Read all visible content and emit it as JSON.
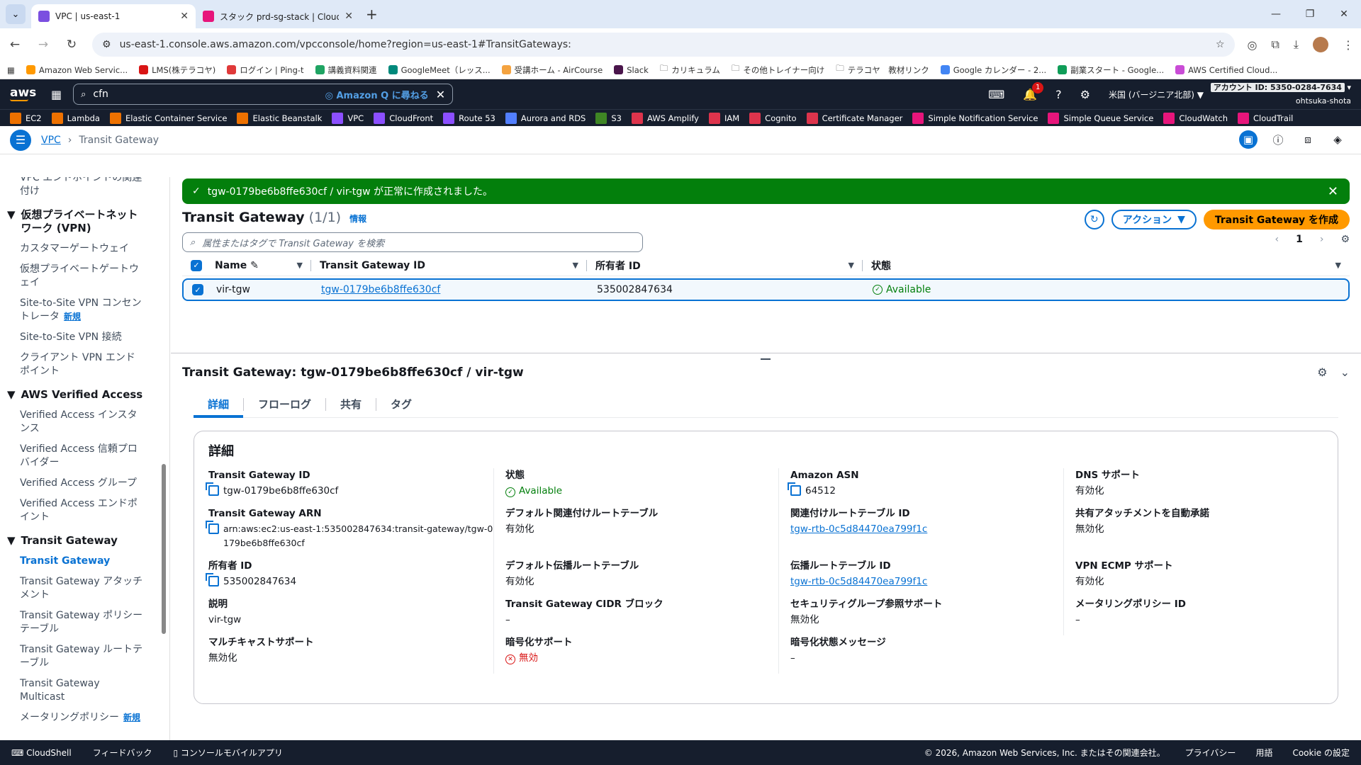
{
  "browser": {
    "tabs": [
      {
        "title": "VPC | us-east-1",
        "color": "#7b4fe0"
      },
      {
        "title": "スタック prd-sg-stack | CloudFor",
        "color": "#e7157b"
      }
    ],
    "url": "us-east-1.console.aws.amazon.com/vpcconsole/home?region=us-east-1#TransitGateways:"
  },
  "bookmarks": [
    {
      "label": "Amazon Web Servic...",
      "color": "#ff9900"
    },
    {
      "label": "LMS(株テラコヤ)",
      "color": "#d91515"
    },
    {
      "label": "ログイン | Ping-t",
      "color": "#e03a3a"
    },
    {
      "label": "講義資料関連",
      "color": "#1fa463"
    },
    {
      "label": "GoogleMeet（レッス...",
      "color": "#00897b"
    },
    {
      "label": "受講ホーム - AirCourse",
      "color": "#f4a340"
    },
    {
      "label": "Slack",
      "color": "#4a154b"
    },
    {
      "label": "カリキュラム",
      "color": "#777"
    },
    {
      "label": "その他トレイナー向け",
      "color": "#777"
    },
    {
      "label": "テラコヤ　教材リンク",
      "color": "#777"
    },
    {
      "label": "Google カレンダー - 2...",
      "color": "#4285f4"
    },
    {
      "label": "副業スタート - Google...",
      "color": "#0f9d58"
    },
    {
      "label": "AWS Certified Cloud...",
      "color": "#c94cd6"
    }
  ],
  "aws": {
    "search_value": "cfn",
    "amazon_q": "Amazon Q に尋ねる",
    "notification_count": "1",
    "region": "米国 (バージニア北部)",
    "account_id": "アカウント ID: 5350-0284-7634",
    "user": "ohtsuka-shota",
    "favorites": [
      {
        "label": "EC2",
        "color": "#ed7100"
      },
      {
        "label": "Lambda",
        "color": "#ed7100"
      },
      {
        "label": "Elastic Container Service",
        "color": "#ed7100"
      },
      {
        "label": "Elastic Beanstalk",
        "color": "#ed7100"
      },
      {
        "label": "VPC",
        "color": "#8c4fff"
      },
      {
        "label": "CloudFront",
        "color": "#8c4fff"
      },
      {
        "label": "Route 53",
        "color": "#8c4fff"
      },
      {
        "label": "Aurora and RDS",
        "color": "#527fff"
      },
      {
        "label": "S3",
        "color": "#3f8624"
      },
      {
        "label": "AWS Amplify",
        "color": "#dd344c"
      },
      {
        "label": "IAM",
        "color": "#dd344c"
      },
      {
        "label": "Cognito",
        "color": "#dd344c"
      },
      {
        "label": "Certificate Manager",
        "color": "#dd344c"
      },
      {
        "label": "Simple Notification Service",
        "color": "#e7157b"
      },
      {
        "label": "Simple Queue Service",
        "color": "#e7157b"
      },
      {
        "label": "CloudWatch",
        "color": "#e7157b"
      },
      {
        "label": "CloudTrail",
        "color": "#e7157b"
      }
    ]
  },
  "breadcrumb": {
    "root": "VPC",
    "current": "Transit Gateway"
  },
  "sidebar": {
    "items_top": [
      "VPC エンドポイントの関連付け"
    ],
    "vpn_section": "仮想プライベートネットワーク (VPN)",
    "vpn_items": [
      "カスタマーゲートウェイ",
      "仮想プライベートゲートウェイ",
      "Site-to-Site VPN コンセントレータ",
      "Site-to-Site VPN 接続",
      "クライアント VPN エンドポイント"
    ],
    "new_label": "新規",
    "va_section": "AWS Verified Access",
    "va_items": [
      "Verified Access インスタンス",
      "Verified Access 信頼プロバイダー",
      "Verified Access グループ",
      "Verified Access エンドポイント"
    ],
    "tgw_section": "Transit Gateway",
    "tgw_items": [
      "Transit Gateway",
      "Transit Gateway アタッチメント",
      "Transit Gateway ポリシーテーブル",
      "Transit Gateway ルートテーブル",
      "Transit Gateway Multicast",
      "メータリングポリシー"
    ]
  },
  "flash": {
    "message": "tgw-0179be6b8ffe630cf / vir-tgw が正常に作成されました。"
  },
  "table": {
    "title": "Transit Gateway",
    "count": "(1/1)",
    "info": "情報",
    "actions_label": "アクション",
    "create_label": "Transit Gateway を作成",
    "filter_placeholder": "属性またはタグで Transit Gateway を検索",
    "page": "1",
    "columns": [
      "Name",
      "Transit Gateway ID",
      "所有者 ID",
      "状態"
    ],
    "rows": [
      {
        "name": "vir-tgw",
        "id": "tgw-0179be6b8ffe630cf",
        "owner": "535002847634",
        "state": "Available"
      }
    ]
  },
  "details": {
    "title": "Transit Gateway: tgw-0179be6b8ffe630cf / vir-tgw",
    "tabs": [
      "詳細",
      "フローログ",
      "共有",
      "タグ"
    ],
    "section": "詳細",
    "fields": {
      "tgw_id": {
        "k": "Transit Gateway ID",
        "v": "tgw-0179be6b8ffe630cf"
      },
      "state": {
        "k": "状態",
        "v": "Available"
      },
      "asn": {
        "k": "Amazon ASN",
        "v": "64512"
      },
      "dns": {
        "k": "DNS サポート",
        "v": "有効化"
      },
      "arn": {
        "k": "Transit Gateway ARN",
        "v": "arn:aws:ec2:us-east-1:535002847634:transit-gateway/tgw-0179be6b8ffe630cf"
      },
      "def_assoc": {
        "k": "デフォルト関連付けルートテーブル",
        "v": "有効化"
      },
      "assoc_rt": {
        "k": "関連付けルートテーブル ID",
        "v": "tgw-rtb-0c5d84470ea799f1c"
      },
      "auto_accept": {
        "k": "共有アタッチメントを自動承諾",
        "v": "無効化"
      },
      "owner": {
        "k": "所有者 ID",
        "v": "535002847634"
      },
      "def_prop": {
        "k": "デフォルト伝播ルートテーブル",
        "v": "有効化"
      },
      "prop_rt": {
        "k": "伝播ルートテーブル ID",
        "v": "tgw-rtb-0c5d84470ea799f1c"
      },
      "ecmp": {
        "k": "VPN ECMP サポート",
        "v": "有効化"
      },
      "desc": {
        "k": "説明",
        "v": "vir-tgw"
      },
      "cidr": {
        "k": "Transit Gateway CIDR ブロック",
        "v": "–"
      },
      "sg_ref": {
        "k": "セキュリティグループ参照サポート",
        "v": "無効化"
      },
      "meter": {
        "k": "メータリングポリシー ID",
        "v": "–"
      },
      "mcast": {
        "k": "マルチキャストサポート",
        "v": "無効化"
      },
      "enc": {
        "k": "暗号化サポート",
        "v": "無効"
      },
      "enc_msg": {
        "k": "暗号化状態メッセージ",
        "v": "–"
      }
    }
  },
  "footer": {
    "cloudshell": "CloudShell",
    "feedback": "フィードバック",
    "mobile": "コンソールモバイルアプリ",
    "copyright": "© 2026, Amazon Web Services, Inc. またはその関連会社。",
    "privacy": "プライバシー",
    "terms": "用語",
    "cookie": "Cookie の設定"
  }
}
